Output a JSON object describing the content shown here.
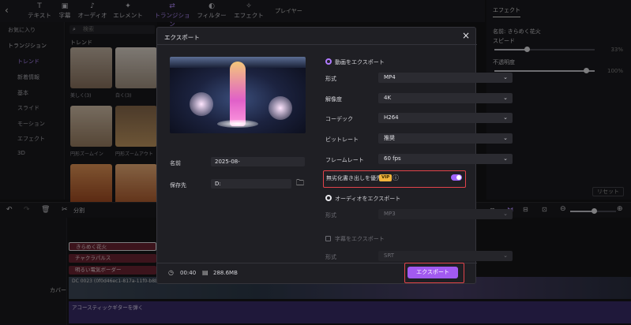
{
  "toolbar": {
    "tabs": [
      {
        "label": "テキスト",
        "icon": "T"
      },
      {
        "label": "字幕",
        "icon": "▣"
      },
      {
        "label": "オーディオ",
        "icon": "♪"
      },
      {
        "label": "エレメント",
        "icon": "✦"
      },
      {
        "label": "トランジション",
        "icon": "⇄"
      },
      {
        "label": "フィルター",
        "icon": "◐"
      },
      {
        "label": "エフェクト",
        "icon": "✧"
      }
    ]
  },
  "sidebar": {
    "favorites": "お気に入り",
    "section": "トランジション",
    "items": [
      "トレンド",
      "新着情報",
      "基本",
      "スライド",
      "モーション",
      "エフェクト",
      "3D"
    ]
  },
  "media": {
    "search_placeholder": "検索",
    "heading": "トレンド",
    "thumbs": [
      "美しく(3)",
      "白く(3)",
      "円形ズームイン",
      "円形ズームアウト"
    ]
  },
  "player": {
    "title": "プレイヤー"
  },
  "right_panel": {
    "tab": "エフェクト",
    "name": "名前: きらめく花火",
    "speed_label": "スピード",
    "speed_value": "33%",
    "opacity_label": "不透明度",
    "opacity_value": "100%",
    "reset": "リセット"
  },
  "timeline_toolbar": {
    "split": "分割"
  },
  "timeline": {
    "clips": [
      "きらめく花火",
      "チャクラパルス",
      "明るい電気ボーダー"
    ],
    "video_clip": "DC 0023 (0f0d46ec1-817a-11f0-b8bb-2e81b5e0241.mp4)",
    "cover": "カバー",
    "audio_clip": "アコースティックギターを弾く"
  },
  "modal": {
    "title": "エクスポート",
    "name_label": "名前",
    "name_value": "2025-08-",
    "save_label": "保存先",
    "save_value": "D:",
    "video_export": "動画をエクスポート",
    "format_label": "形式",
    "format_value": "MP4",
    "resolution_label": "解像度",
    "resolution_value": "4K",
    "codec_label": "コーデック",
    "codec_value": "H264",
    "bitrate_label": "ビットレート",
    "bitrate_value": "推奨",
    "framerate_label": "フレームレート",
    "framerate_value": "60  fps",
    "priority_label": "無劣化書き出しを優先",
    "vip": "VIP",
    "audio_export": "オーディオをエクスポート",
    "audio_format_label": "形式",
    "audio_format_value": "MP3",
    "subtitle_export": "字幕をエクスポート",
    "subtitle_format_label": "形式",
    "subtitle_format_value": "SRT",
    "duration": "00:40",
    "size": "288.6MB",
    "export_button": "エクスポート"
  }
}
